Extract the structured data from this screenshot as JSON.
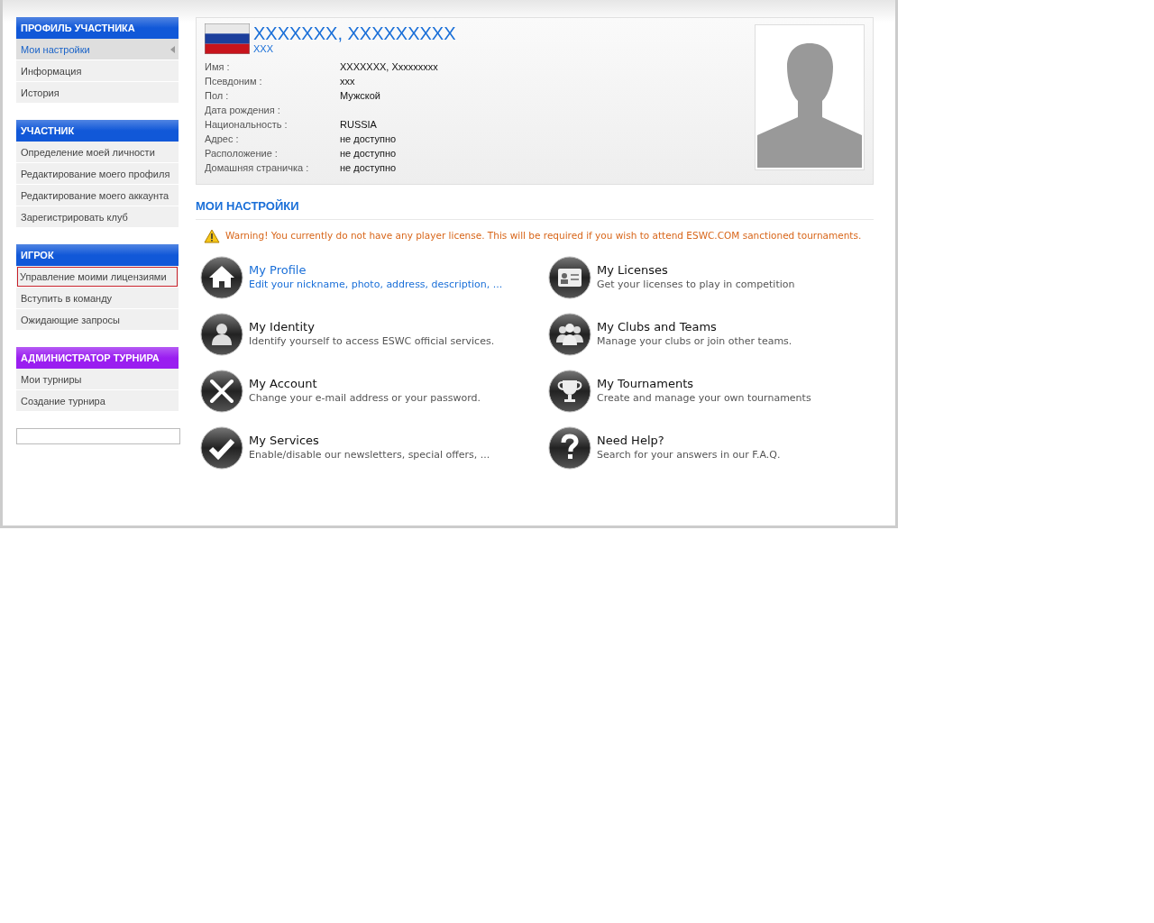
{
  "sidebar": [
    {
      "title": "ПРОФИЛЬ УЧАСТНИКА",
      "color": "#1158d8",
      "items": [
        {
          "label": "Мои настройки",
          "selected": true,
          "highlighted": false
        },
        {
          "label": "Информация",
          "selected": false,
          "highlighted": false
        },
        {
          "label": "История",
          "selected": false,
          "highlighted": false
        }
      ]
    },
    {
      "title": "УЧАСТНИК",
      "color": "#1158d8",
      "items": [
        {
          "label": "Определение моей личности",
          "selected": false,
          "highlighted": false
        },
        {
          "label": "Редактирование моего профиля",
          "selected": false,
          "highlighted": false
        },
        {
          "label": "Редактирование моего аккаунта",
          "selected": false,
          "highlighted": false
        },
        {
          "label": "Зарегистрировать клуб",
          "selected": false,
          "highlighted": false
        }
      ]
    },
    {
      "title": "ИГРОК",
      "color": "#1158d8",
      "items": [
        {
          "label": "Управление моими лицензиями",
          "selected": false,
          "highlighted": true
        },
        {
          "label": "Вступить в команду",
          "selected": false,
          "highlighted": false
        },
        {
          "label": "Ожидающие запросы",
          "selected": false,
          "highlighted": false
        }
      ]
    },
    {
      "title": "АДМИНИСТРАТОР ТУРНИРА",
      "color": "#9a1ef0",
      "items": [
        {
          "label": "Мои турниры",
          "selected": false,
          "highlighted": false
        },
        {
          "label": "Создание турнира",
          "selected": false,
          "highlighted": false
        }
      ]
    }
  ],
  "profile": {
    "name": "XXXXXXX, XXXXXXXXX",
    "nickname": "XXX",
    "fields": [
      {
        "label": "Имя :",
        "value": "XXXXXXX, Xxxxxxxxx"
      },
      {
        "label": "Псевдоним :",
        "value": "xxx"
      },
      {
        "label": "Пол :",
        "value": "Мужской"
      },
      {
        "label": "Дата рождения :"
      },
      {
        "label": "Национальность :",
        "value": "RUSSIA"
      },
      {
        "label": "Адрес :",
        "value": "не доступно"
      },
      {
        "label": "Расположение :",
        "value": "не доступно"
      },
      {
        "label": "Домашняя страничка :",
        "value": "не доступно"
      }
    ]
  },
  "section_title": "МОИ НАСТРОЙКИ",
  "warning": "Warning! You currently do not have any player license. This will be required if you wish to attend ESWC.COM sanctioned tournaments.",
  "tiles": [
    {
      "title": "My Profile",
      "description": "Edit your nickname, photo, address, description, ...",
      "selected": true
    },
    {
      "title": "My Licenses",
      "description": "Get your licenses to play in competition",
      "selected": false
    },
    {
      "title": "My Identity",
      "description": "Identify yourself to access ESWC official services.",
      "selected": false
    },
    {
      "title": "My Clubs and Teams",
      "description": "Manage your clubs or join other teams.",
      "selected": false
    },
    {
      "title": "My Account",
      "description": "Change your e-mail address or your password.",
      "selected": false
    },
    {
      "title": "My Tournaments",
      "description": "Create and manage your own tournaments",
      "selected": false
    },
    {
      "title": "My Services",
      "description": "Enable/disable our newsletters, special offers, ...",
      "selected": false
    },
    {
      "title": "Need Help?",
      "description": "Search for your answers in our F.A.Q.",
      "selected": false
    }
  ]
}
